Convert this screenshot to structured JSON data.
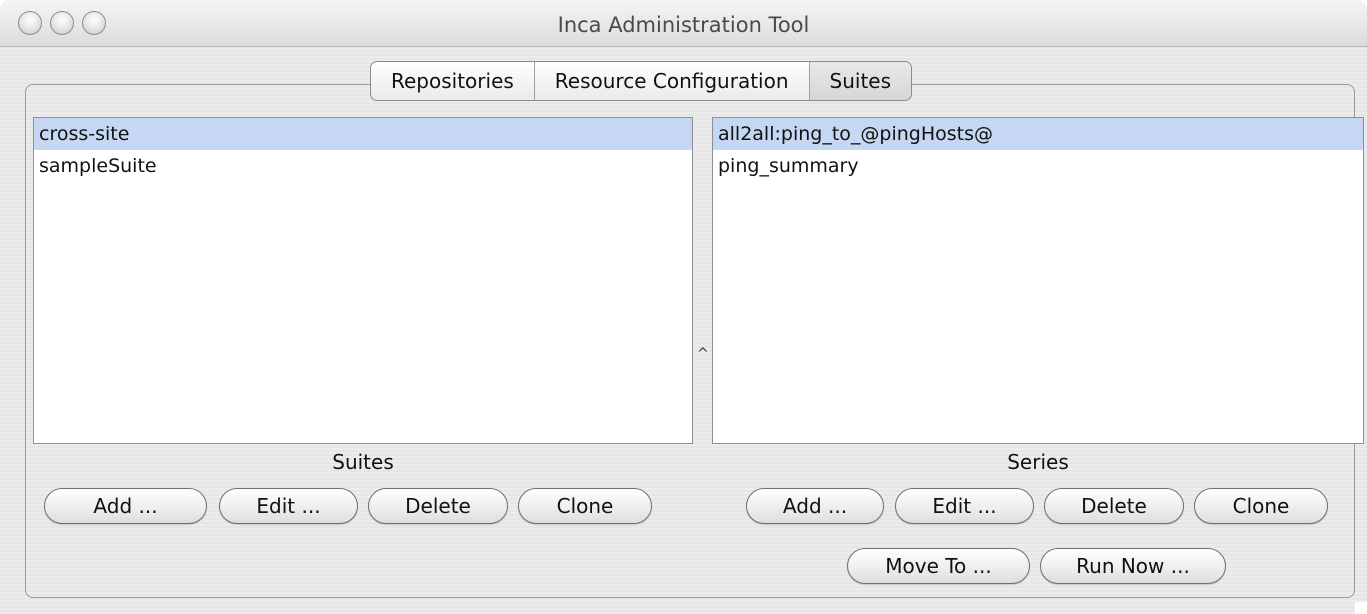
{
  "window": {
    "title": "Inca Administration Tool"
  },
  "tabs": [
    {
      "label": "Repositories"
    },
    {
      "label": "Resource Configuration"
    },
    {
      "label": "Suites"
    }
  ],
  "suites_panel": {
    "items": [
      "cross-site",
      "sampleSuite"
    ],
    "selected": "cross-site",
    "caption": "Suites",
    "buttons": {
      "add": "Add ...",
      "edit": "Edit ...",
      "delete": "Delete",
      "clone": "Clone"
    }
  },
  "series_panel": {
    "items": [
      "all2all:ping_to_@pingHosts@",
      "ping_summary"
    ],
    "selected": "all2all:ping_to_@pingHosts@",
    "caption": "Series",
    "buttons": {
      "add": "Add ...",
      "edit": "Edit ...",
      "delete": "Delete",
      "clone": "Clone",
      "move_to": "Move To ...",
      "run_now": "Run Now ..."
    }
  },
  "splitter": {
    "glyph": "^"
  },
  "colors": {
    "selection": "#c5d7f2",
    "window_bg": "#ececec"
  }
}
